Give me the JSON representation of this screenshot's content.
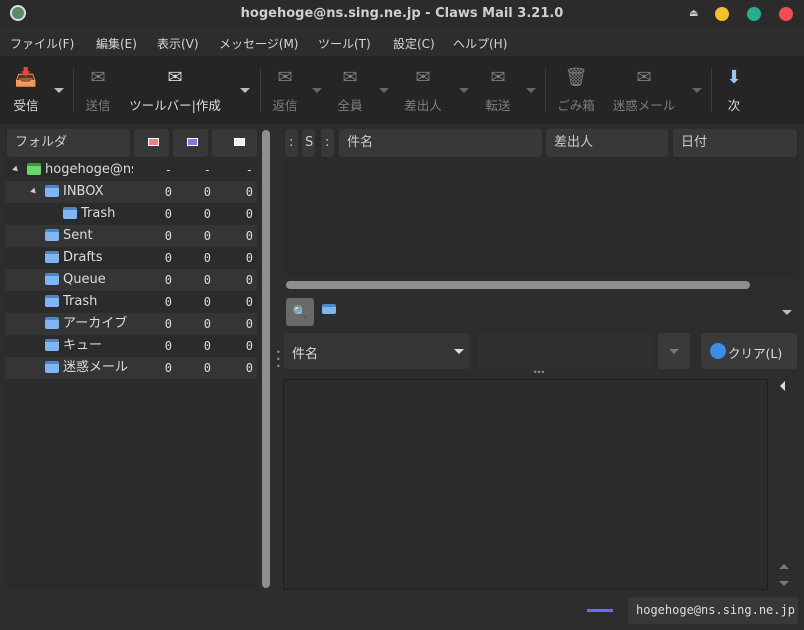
{
  "window": {
    "title": "hogehoge@ns.sing.ne.jp - Claws Mail 3.21.0"
  },
  "menu": [
    "ファイル(F)",
    "編集(E)",
    "表示(V)",
    "メッセージ(M)",
    "ツール(T)",
    "設定(C)",
    "ヘルプ(H)"
  ],
  "toolbar": {
    "receive": "受信",
    "send": "送信",
    "compose": "ツールバー|作成",
    "reply": "返信",
    "reply_all": "全員",
    "reply_sender": "差出人",
    "forward": "転送",
    "trash": "ごみ箱",
    "spam": "迷惑メール",
    "next": "次"
  },
  "folder_pane": {
    "header": "フォルダ",
    "rows": [
      {
        "name": "hogehoge@ns",
        "new": "-",
        "unread": "-",
        "total": "-"
      },
      {
        "name": "INBOX",
        "new": "0",
        "unread": "0",
        "total": "0"
      },
      {
        "name": "Trash",
        "new": "0",
        "unread": "0",
        "total": "0"
      },
      {
        "name": "Sent",
        "new": "0",
        "unread": "0",
        "total": "0"
      },
      {
        "name": "Drafts",
        "new": "0",
        "unread": "0",
        "total": "0"
      },
      {
        "name": "Queue",
        "new": "0",
        "unread": "0",
        "total": "0"
      },
      {
        "name": "Trash",
        "new": "0",
        "unread": "0",
        "total": "0"
      },
      {
        "name": "アーカイブ",
        "new": "0",
        "unread": "0",
        "total": "0"
      },
      {
        "name": "キュー",
        "new": "0",
        "unread": "0",
        "total": "0"
      },
      {
        "name": "迷惑メール",
        "new": "0",
        "unread": "0",
        "total": "0"
      }
    ]
  },
  "message_list": {
    "col_mark": ":",
    "col_s": "S",
    "col_attach": ":",
    "col_subject": "件名",
    "col_from": "差出人",
    "col_date": "日付"
  },
  "search": {
    "field": "件名",
    "value": "",
    "clear": "クリア(L)"
  },
  "status": {
    "account": "hogehoge@ns.sing.ne.jp"
  }
}
